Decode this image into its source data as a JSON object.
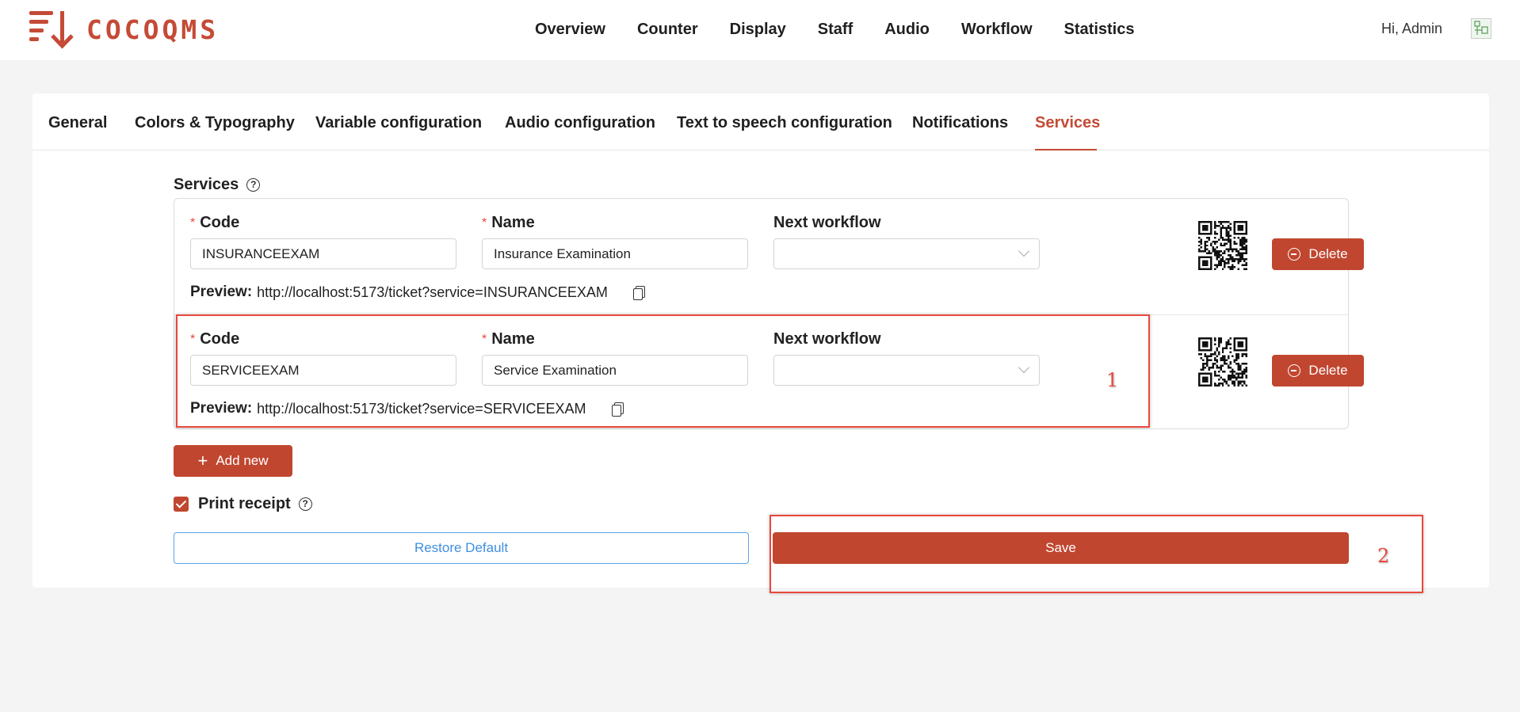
{
  "header": {
    "logo_text": "COCOQMS",
    "nav": [
      "Overview",
      "Counter",
      "Display",
      "Staff",
      "Audio",
      "Workflow",
      "Statistics"
    ],
    "greeting": "Hi, Admin"
  },
  "tabs": [
    {
      "label": "General",
      "active": false
    },
    {
      "label": "Colors & Typography",
      "active": false
    },
    {
      "label": "Variable configuration",
      "active": false
    },
    {
      "label": "Audio configuration",
      "active": false
    },
    {
      "label": "Text to speech configuration",
      "active": false
    },
    {
      "label": "Notifications",
      "active": false
    },
    {
      "label": "Services",
      "active": true
    }
  ],
  "services_section": {
    "title": "Services",
    "help_glyph": "?",
    "code_label": "Code",
    "name_label": "Name",
    "workflow_label": "Next workflow",
    "preview_label": "Preview:",
    "delete_label": "Delete",
    "rows": [
      {
        "code": "INSURANCEEXAM",
        "name": "Insurance Examination",
        "next_workflow": "",
        "preview_url": "http://localhost:5173/ticket?service=INSURANCEEXAM"
      },
      {
        "code": "SERVICEEXAM",
        "name": "Service Examination",
        "next_workflow": "",
        "preview_url": "http://localhost:5173/ticket?service=SERVICEEXAM"
      }
    ]
  },
  "actions": {
    "add_new_label": "Add new",
    "add_icon_glyph": "+",
    "print_receipt_label": "Print receipt",
    "print_receipt_checked": true,
    "restore_label": "Restore Default",
    "save_label": "Save"
  },
  "annotations": {
    "marker_1": "1",
    "marker_2": "2",
    "color": "#e8483c"
  },
  "colors": {
    "brand": "#c0462f",
    "link_blue": "#3f8fe0",
    "required": "#e8483c"
  }
}
